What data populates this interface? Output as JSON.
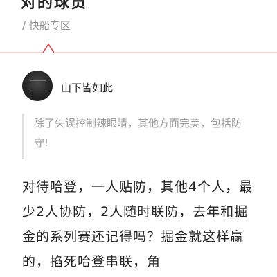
{
  "post": {
    "title": "对的球员",
    "tag": "/ 快船专区"
  },
  "reply": {
    "username": "山下皆如此",
    "quote": "除了失误控制辣眼睛，其他方面完美，包括防守!",
    "body": "对待哈登，一人贴防，其他4个人，最少2人协防，2人随时联防，去年和掘金的系列赛还记得吗？掘金就这样赢的，掐死哈登串联，角"
  },
  "colors": {
    "accent": "#e8383d",
    "separator_line": "#f3c6c8",
    "muted_text": "#9a9a9a",
    "quote_bar": "#e0e0e0"
  }
}
